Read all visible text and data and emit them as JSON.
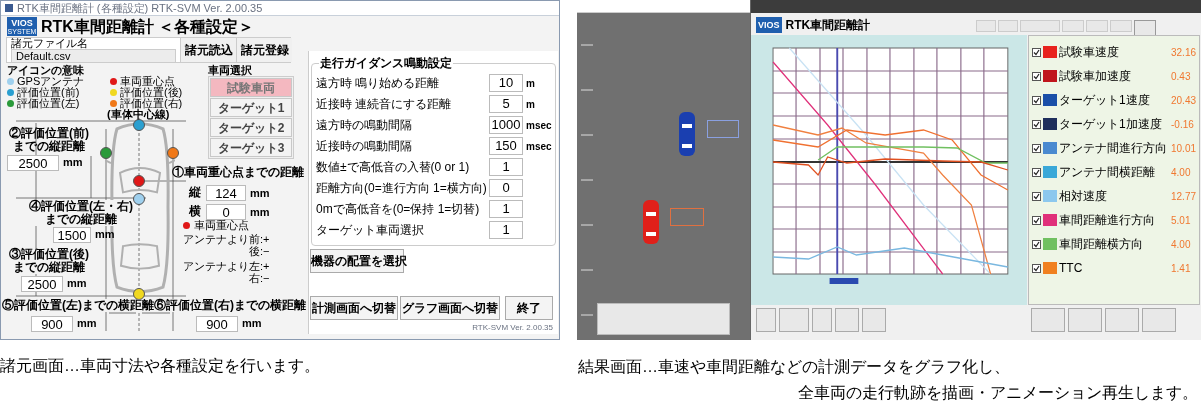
{
  "settings_screen": {
    "window_title": "RTK車間距離計 (各種設定) RTK-SVM Ver. 2.00.35",
    "logo": {
      "top": "VIOS",
      "bottom": "SYSTEM"
    },
    "heading": "RTK車間距離計 ＜各種設定＞",
    "spec_file": {
      "label": "諸元ファイル名",
      "value": "Default.csv"
    },
    "file_buttons": [
      "諸元読込",
      "諸元登録"
    ],
    "icon_legend": {
      "title": "アイコンの意味",
      "items": [
        {
          "label": "GPSアンテナ",
          "color": "#9fd0ee"
        },
        {
          "label": "評価位置(前)",
          "color": "#2a9fd0"
        },
        {
          "label": "評価位置(左)",
          "color": "#2a9a3a"
        },
        {
          "label": "車両重心点",
          "color": "#e01818"
        },
        {
          "label": "評価位置(後)",
          "color": "#f0d820"
        },
        {
          "label": "評価位置(右)",
          "color": "#f07818"
        }
      ]
    },
    "vehicle_select": {
      "title": "車両選択",
      "items": [
        {
          "label": "試験車両",
          "selected": true
        },
        {
          "label": "ターゲット1",
          "selected": false
        },
        {
          "label": "ターゲット2",
          "selected": false
        },
        {
          "label": "ターゲット3",
          "selected": false
        }
      ]
    },
    "diagram": {
      "centerline_label": "(車体中心線)",
      "front": {
        "label": [
          "②評価位置(前)",
          "までの縦距離"
        ],
        "value": "2500",
        "unit": "mm"
      },
      "cog": {
        "label": "①車両重心点までの距離",
        "long_label": "縦",
        "long_value": "124",
        "long_unit": "mm",
        "lat_label": "横",
        "lat_value": "0",
        "lat_unit": "mm",
        "marker_label": "車両重心点",
        "note_long": [
          "アンテナより前:+",
          "後:−"
        ],
        "note_lat": [
          "アンテナより左:+",
          "右:−"
        ]
      },
      "side": {
        "label": [
          "④評価位置(左・右)",
          "までの縦距離"
        ],
        "value": "1500",
        "unit": "mm"
      },
      "rear": {
        "label": [
          "③評価位置(後)",
          "までの縦距離"
        ],
        "value": "2500",
        "unit": "mm"
      },
      "left": {
        "label": "⑤評価位置(左)までの横距離",
        "value": "900",
        "unit": "mm"
      },
      "right": {
        "label": "⑥評価位置(右)までの横距離",
        "value": "900",
        "unit": "mm"
      }
    },
    "guidance": {
      "title": "走行ガイダンス鳴動設定",
      "rows": [
        {
          "label": "遠方時 鳴り始める距離",
          "value": "10",
          "unit": "m"
        },
        {
          "label": "近接時 連続音にする距離",
          "value": "5",
          "unit": "m"
        },
        {
          "label": "遠方時の鳴動間隔",
          "value": "1000",
          "unit": "msec"
        },
        {
          "label": "近接時の鳴動間隔",
          "value": "150",
          "unit": "msec"
        },
        {
          "label": "数値±で高低音の入替(0 or 1)",
          "value": "1"
        },
        {
          "label": "距離方向(0=進行方向 1=横方向)",
          "value": "0"
        },
        {
          "label": "0mで高低音を(0=保持 1=切替)",
          "value": "1"
        },
        {
          "label": "ターゲット車両選択",
          "value": "1"
        }
      ]
    },
    "layout_button": "機器の配置を選択",
    "footer_buttons": [
      "計測画面へ切替",
      "グラフ画面へ切替",
      "終了"
    ],
    "version": "RTK-SVM Ver. 2.00.35"
  },
  "result_screen": {
    "logo": "VIOS",
    "title": "RTK車間距離計",
    "legend": [
      {
        "label": "試験車速度",
        "color": "#e8231e",
        "checked": true,
        "value": "32.16"
      },
      {
        "label": "試験車加速度",
        "color": "#c0151c",
        "checked": true,
        "value": "0.43"
      },
      {
        "label": "ターゲット1速度",
        "color": "#1a4fa8",
        "checked": true,
        "value": "20.43"
      },
      {
        "label": "ターゲット1加速度",
        "color": "#1f2f5c",
        "checked": true,
        "value": "-0.16"
      },
      {
        "label": "アンテナ間進行方向",
        "color": "#4a8ad0",
        "checked": true,
        "value": "10.01"
      },
      {
        "label": "アンテナ間横距離",
        "color": "#3aa8d8",
        "checked": true,
        "value": "4.00"
      },
      {
        "label": "相対速度",
        "color": "#8cc8ee",
        "checked": true,
        "value": "12.77"
      },
      {
        "label": "車間距離進行方向",
        "color": "#e0307a",
        "checked": true,
        "value": "5.01"
      },
      {
        "label": "車間距離横方向",
        "color": "#70c060",
        "checked": true,
        "value": "4.00"
      },
      {
        "label": "TTC",
        "color": "#f08020",
        "checked": true,
        "value": "1.41"
      }
    ]
  },
  "captions": {
    "settings": "諸元画面…車両寸法や各種設定を行います。",
    "result": [
      "結果画面…車速や車間距離などの計測データをグラフ化し、",
      "全車両の走行軌跡を描画・アニメーション再生します。"
    ]
  }
}
